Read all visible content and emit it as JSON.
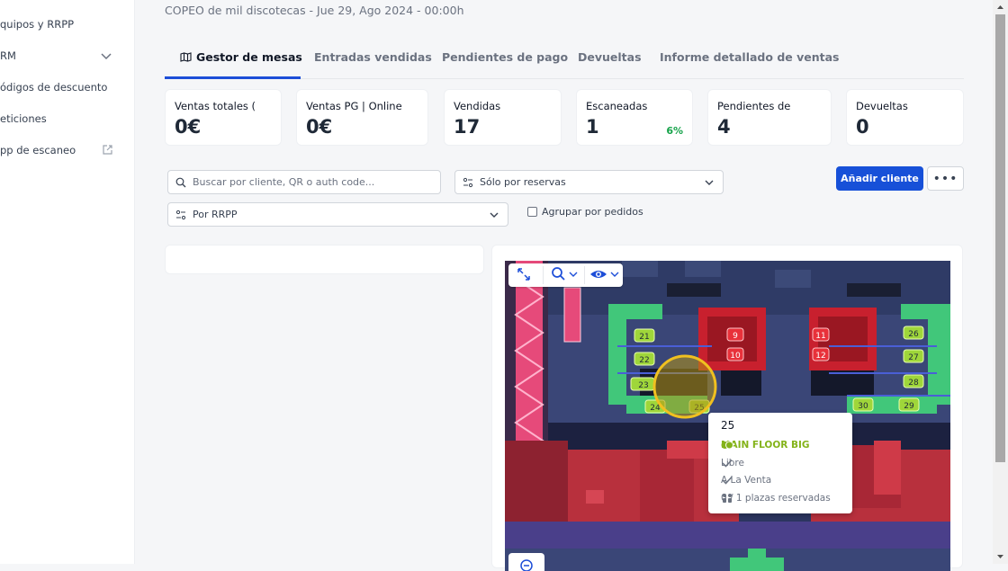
{
  "sidebar": {
    "items": [
      {
        "label": "quipos y RRPP"
      },
      {
        "label": "RM"
      },
      {
        "label": "ódigos de descuento"
      },
      {
        "label": "eticiones"
      },
      {
        "label": "pp de escaneo"
      }
    ]
  },
  "event": {
    "title": "COPEO de mil discotecas - Jue 29, Ago 2024 - 00:00h"
  },
  "tabs": [
    {
      "label": "Gestor de mesas"
    },
    {
      "label": "Entradas vendidas"
    },
    {
      "label": "Pendientes de pago"
    },
    {
      "label": "Devueltas"
    },
    {
      "label": "Informe detallado de ventas"
    }
  ],
  "stats": [
    {
      "label": "Ventas totales (",
      "value": "0€"
    },
    {
      "label": "Ventas PG | Online",
      "value": "0€"
    },
    {
      "label": "Vendidas",
      "value": "17"
    },
    {
      "label": "Escaneadas",
      "value": "1",
      "percent": "6%"
    },
    {
      "label": "Pendientes de pa",
      "value": "4"
    },
    {
      "label": "Devueltas",
      "value": "0"
    }
  ],
  "filters": {
    "search_placeholder": "Buscar por cliente, QR o auth code...",
    "reservation_filter": "Sólo por reservas",
    "rrpp_filter": "Por RRPP",
    "group_by_orders": "Agrupar por pedidos",
    "group_by_orders_checked": false
  },
  "actions": {
    "add_client": "Añadir cliente",
    "more": "•••"
  },
  "map": {
    "tables": [
      {
        "label": "21",
        "color": "#9fd63a"
      },
      {
        "label": "22",
        "color": "#9fd63a"
      },
      {
        "label": "23",
        "color": "#9fd63a"
      },
      {
        "label": "24",
        "color": "#9fd63a"
      },
      {
        "label": "25",
        "color": "#9fd63a"
      },
      {
        "label": "9",
        "color": "#e8313a"
      },
      {
        "label": "10",
        "color": "#e8313a"
      },
      {
        "label": "11",
        "color": "#e8313a"
      },
      {
        "label": "12",
        "color": "#e8313a"
      },
      {
        "label": "26",
        "color": "#9fd63a"
      },
      {
        "label": "27",
        "color": "#9fd63a"
      },
      {
        "label": "28",
        "color": "#9fd63a"
      },
      {
        "label": "29",
        "color": "#9fd63a"
      },
      {
        "label": "30",
        "color": "#9fd63a"
      }
    ],
    "tooltip": {
      "number": "25",
      "zone": "MAIN FLOOR BIG",
      "status": "Libre",
      "sale": "A La Venta",
      "seats": "0 / 1 plazas reservadas"
    }
  },
  "colors": {
    "accent": "#1750d8",
    "success": "#16a34a",
    "zone": "#84b31a"
  }
}
